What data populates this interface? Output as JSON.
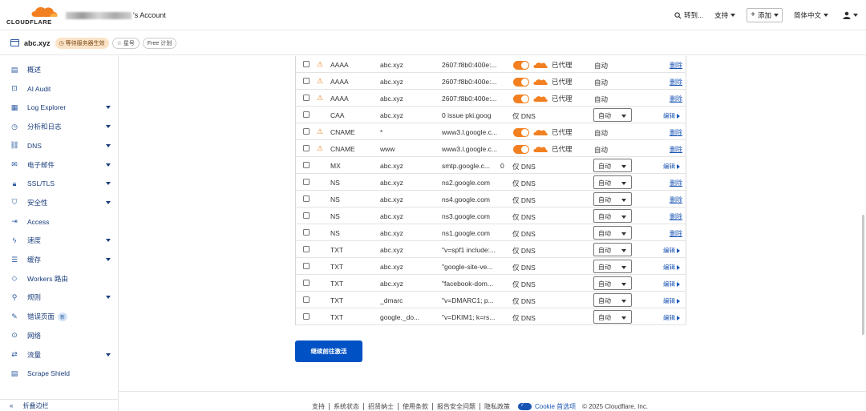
{
  "header": {
    "logo_text": "CLOUDFLARE",
    "account_suffix": "'s Account",
    "search_label": "转到...",
    "support_label": "支持",
    "add_label": "添加",
    "language_label": "简体中文",
    "brand_color": "#f38020"
  },
  "zone": {
    "name": "abc.xyz",
    "status_badge": "等待服务器生效",
    "star_label": "星号",
    "plan_label": "Free 计划"
  },
  "sidebar": {
    "items": [
      {
        "label": "概述",
        "icon": "document-icon",
        "caret": false
      },
      {
        "label": "AI Audit",
        "icon": "ai-audit-icon",
        "caret": false
      },
      {
        "label": "Log Explorer",
        "icon": "log-explorer-icon",
        "caret": true
      },
      {
        "label": "分析和日志",
        "icon": "clock-icon",
        "caret": true
      },
      {
        "label": "DNS",
        "icon": "network-icon",
        "caret": true
      },
      {
        "label": "电子邮件",
        "icon": "email-icon",
        "caret": true
      },
      {
        "label": "SSL/TLS",
        "icon": "lock-icon",
        "caret": true
      },
      {
        "label": "安全性",
        "icon": "shield-icon",
        "caret": true
      },
      {
        "label": "Access",
        "icon": "access-icon",
        "caret": false
      },
      {
        "label": "速度",
        "icon": "lightning-icon",
        "caret": true
      },
      {
        "label": "缓存",
        "icon": "server-icon",
        "caret": true
      },
      {
        "label": "Workers 路由",
        "icon": "workers-icon",
        "caret": false
      },
      {
        "label": "规则",
        "icon": "rules-icon",
        "caret": true
      },
      {
        "label": "错误页面",
        "icon": "wrench-icon",
        "caret": false,
        "badge": "新"
      },
      {
        "label": "网络",
        "icon": "location-icon",
        "caret": false
      },
      {
        "label": "流量",
        "icon": "traffic-icon",
        "caret": true
      },
      {
        "label": "Scrape Shield",
        "icon": "document-icon",
        "caret": false
      }
    ],
    "collapse_label": "折叠边栏"
  },
  "dns_records": [
    {
      "type": "AAAA",
      "name": "abc.xyz",
      "content": "2607:f8b0:400e:...",
      "priority": "",
      "proxied": true,
      "warning": true,
      "ttl": "自动",
      "action": "删除"
    },
    {
      "type": "AAAA",
      "name": "abc.xyz",
      "content": "2607:f8b0:400e:...",
      "priority": "",
      "proxied": true,
      "warning": true,
      "ttl": "自动",
      "action": "删除"
    },
    {
      "type": "AAAA",
      "name": "abc.xyz",
      "content": "2607:f8b0:400e:...",
      "priority": "",
      "proxied": true,
      "warning": true,
      "ttl": "自动",
      "action": "删除"
    },
    {
      "type": "CAA",
      "name": "abc.xyz",
      "content": "0 issue pki.goog",
      "priority": "",
      "proxied": false,
      "warning": false,
      "ttl": "自动",
      "action": "编辑"
    },
    {
      "type": "CNAME",
      "name": "*",
      "content": "www3.l.google.c...",
      "priority": "",
      "proxied": true,
      "warning": true,
      "ttl": "自动",
      "action": "删除"
    },
    {
      "type": "CNAME",
      "name": "www",
      "content": "www3.l.google.c...",
      "priority": "",
      "proxied": true,
      "warning": true,
      "ttl": "自动",
      "action": "删除"
    },
    {
      "type": "MX",
      "name": "abc.xyz",
      "content": "smtp.google.c...",
      "priority": "0",
      "proxied": false,
      "warning": false,
      "ttl": "自动",
      "action": "编辑"
    },
    {
      "type": "NS",
      "name": "abc.xyz",
      "content": "ns2.google.com",
      "priority": "",
      "proxied": false,
      "warning": false,
      "ttl": "自动",
      "action": "删除"
    },
    {
      "type": "NS",
      "name": "abc.xyz",
      "content": "ns4.google.com",
      "priority": "",
      "proxied": false,
      "warning": false,
      "ttl": "自动",
      "action": "删除"
    },
    {
      "type": "NS",
      "name": "abc.xyz",
      "content": "ns3.google.com",
      "priority": "",
      "proxied": false,
      "warning": false,
      "ttl": "自动",
      "action": "删除"
    },
    {
      "type": "NS",
      "name": "abc.xyz",
      "content": "ns1.google.com",
      "priority": "",
      "proxied": false,
      "warning": false,
      "ttl": "自动",
      "action": "删除"
    },
    {
      "type": "TXT",
      "name": "abc.xyz",
      "content": "\"v=spf1 include:...",
      "priority": "",
      "proxied": false,
      "warning": false,
      "ttl": "自动",
      "action": "编辑"
    },
    {
      "type": "TXT",
      "name": "abc.xyz",
      "content": "\"google-site-ve...",
      "priority": "",
      "proxied": false,
      "warning": false,
      "ttl": "自动",
      "action": "编辑"
    },
    {
      "type": "TXT",
      "name": "abc.xyz",
      "content": "\"facebook-dom...",
      "priority": "",
      "proxied": false,
      "warning": false,
      "ttl": "自动",
      "action": "编辑"
    },
    {
      "type": "TXT",
      "name": "_dmarc",
      "content": "\"v=DMARC1; p...",
      "priority": "",
      "proxied": false,
      "warning": false,
      "ttl": "自动",
      "action": "编辑"
    },
    {
      "type": "TXT",
      "name": "google._do...",
      "content": "\"v=DKIM1; k=rs...",
      "priority": "",
      "proxied": false,
      "warning": false,
      "ttl": "自动",
      "action": "编辑"
    }
  ],
  "labels": {
    "proxied": "已代理",
    "dns_only": "仅 DNS"
  },
  "continue_button": "继续前往激活",
  "footer": {
    "links": [
      "支持",
      "系统状态",
      "招贤纳士",
      "使用条款",
      "报告安全问题",
      "隐私政策"
    ],
    "cookie_label": "Cookie 首选项",
    "copyright": "© 2025 Cloudflare, Inc."
  }
}
